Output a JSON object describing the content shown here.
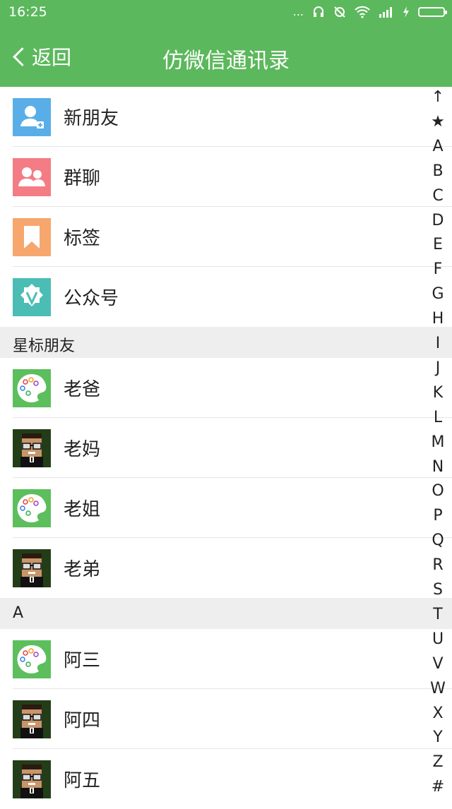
{
  "status_bar": {
    "time": "16:25",
    "dots": "...",
    "accent": "#5cb85c"
  },
  "toolbar": {
    "back_label": "返回",
    "title": "仿微信通讯录"
  },
  "top_items": [
    {
      "label": "新朋友",
      "icon": "new-friend-icon"
    },
    {
      "label": "群聊",
      "icon": "group-chat-icon"
    },
    {
      "label": "标签",
      "icon": "tag-icon"
    },
    {
      "label": "公众号",
      "icon": "official-account-icon"
    }
  ],
  "sections": [
    {
      "header": "星标朋友",
      "contacts": [
        {
          "name": "老爸",
          "avatar": "palette-avatar"
        },
        {
          "name": "老妈",
          "avatar": "pixel-man-avatar"
        },
        {
          "name": "老姐",
          "avatar": "palette-avatar"
        },
        {
          "name": "老弟",
          "avatar": "pixel-man-avatar"
        }
      ]
    },
    {
      "header": "A",
      "contacts": [
        {
          "name": "阿三",
          "avatar": "palette-avatar"
        },
        {
          "name": "阿四",
          "avatar": "pixel-man-avatar"
        },
        {
          "name": "阿五",
          "avatar": "pixel-man-avatar"
        }
      ]
    }
  ],
  "index_bar": [
    "↑",
    "★",
    "A",
    "B",
    "C",
    "D",
    "E",
    "F",
    "G",
    "H",
    "I",
    "J",
    "K",
    "L",
    "M",
    "N",
    "O",
    "P",
    "Q",
    "R",
    "S",
    "T",
    "U",
    "V",
    "W",
    "X",
    "Y",
    "Z",
    "#"
  ]
}
